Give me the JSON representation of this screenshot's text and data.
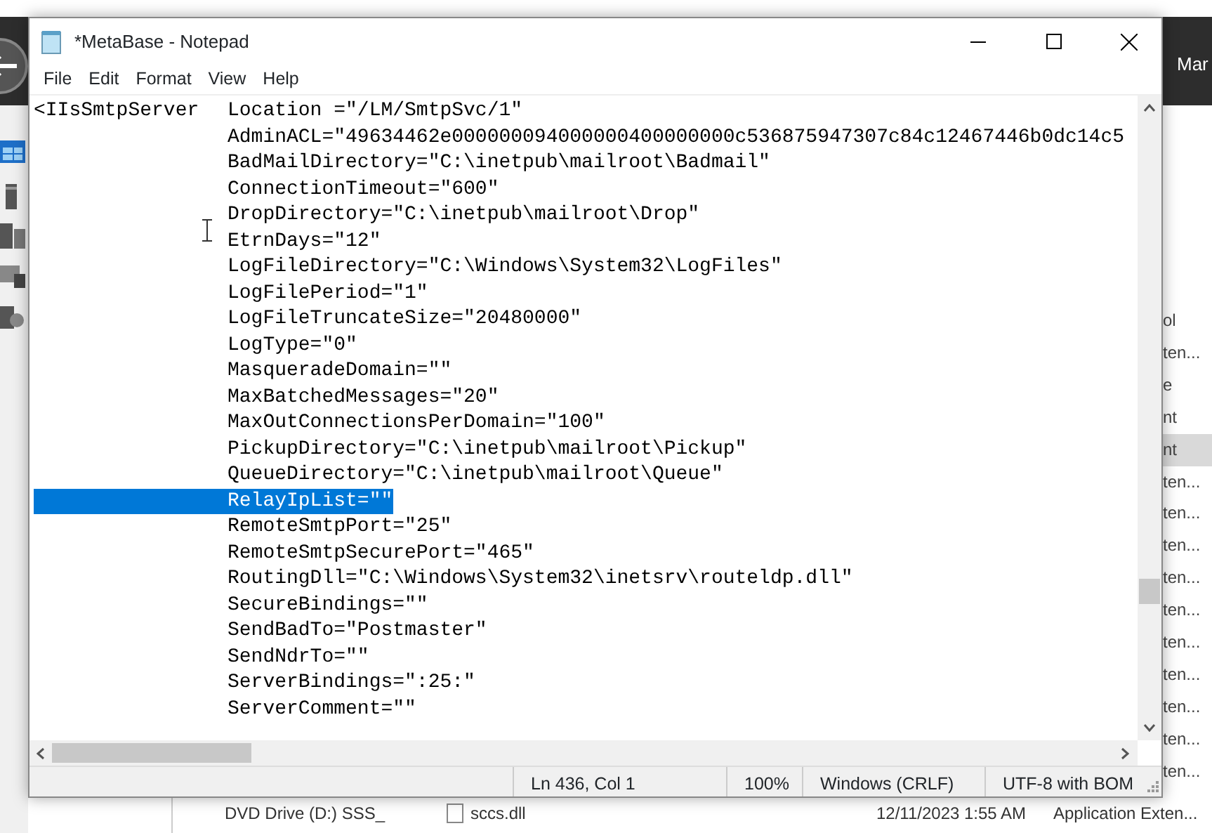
{
  "background": {
    "header_text": "Mar",
    "side_items": [
      {
        "text": "ol",
        "selected": false
      },
      {
        "text": "ten...",
        "selected": false
      },
      {
        "text": "e",
        "selected": false
      },
      {
        "text": "nt",
        "selected": false
      },
      {
        "text": "nt",
        "selected": true
      },
      {
        "text": "ten...",
        "selected": false
      },
      {
        "text": "ten...",
        "selected": false
      },
      {
        "text": "ten...",
        "selected": false
      },
      {
        "text": "ten...",
        "selected": false
      },
      {
        "text": "ten...",
        "selected": false
      },
      {
        "text": "ten...",
        "selected": false
      },
      {
        "text": "ten...",
        "selected": false
      },
      {
        "text": "ten...",
        "selected": false
      },
      {
        "text": "ten...",
        "selected": false
      },
      {
        "text": "ten...",
        "selected": false
      }
    ],
    "files": [
      {
        "name": "DVD Drive (D:) SSS_",
        "file": "sccs.dll",
        "date": "12/11/2023 1:55 AM",
        "type": "Application Exten..."
      }
    ]
  },
  "window": {
    "title": "*MetaBase - Notepad",
    "menu": [
      "File",
      "Edit",
      "Format",
      "View",
      "Help"
    ],
    "lines": [
      {
        "tag": "<IIsSmtpServer",
        "text": "Location =\"/LM/SmtpSvc/1\"",
        "selected": false
      },
      {
        "text": "AdminACL=\"49634462e000000094000000400000000c536875947307c84c12467446b0dc14c5",
        "selected": false
      },
      {
        "text": "BadMailDirectory=\"C:\\inetpub\\mailroot\\Badmail\"",
        "selected": false
      },
      {
        "text": "ConnectionTimeout=\"600\"",
        "selected": false
      },
      {
        "text": "DropDirectory=\"C:\\inetpub\\mailroot\\Drop\"",
        "selected": false
      },
      {
        "text": "EtrnDays=\"12\"",
        "selected": false
      },
      {
        "text": "LogFileDirectory=\"C:\\Windows\\System32\\LogFiles\"",
        "selected": false
      },
      {
        "text": "LogFilePeriod=\"1\"",
        "selected": false
      },
      {
        "text": "LogFileTruncateSize=\"20480000\"",
        "selected": false
      },
      {
        "text": "LogType=\"0\"",
        "selected": false
      },
      {
        "text": "MasqueradeDomain=\"\"",
        "selected": false
      },
      {
        "text": "MaxBatchedMessages=\"20\"",
        "selected": false
      },
      {
        "text": "MaxOutConnectionsPerDomain=\"100\"",
        "selected": false
      },
      {
        "text": "PickupDirectory=\"C:\\inetpub\\mailroot\\Pickup\"",
        "selected": false
      },
      {
        "text": "QueueDirectory=\"C:\\inetpub\\mailroot\\Queue\"",
        "selected": false
      },
      {
        "text": "RelayIpList=\"\"",
        "selected": true
      },
      {
        "text": "RemoteSmtpPort=\"25\"",
        "selected": false
      },
      {
        "text": "RemoteSmtpSecurePort=\"465\"",
        "selected": false
      },
      {
        "text": "RoutingDll=\"C:\\Windows\\System32\\inetsrv\\routeldp.dll\"",
        "selected": false
      },
      {
        "text": "SecureBindings=\"\"",
        "selected": false
      },
      {
        "text": "SendBadTo=\"Postmaster\"",
        "selected": false
      },
      {
        "text": "SendNdrTo=\"\"",
        "selected": false
      },
      {
        "text": "ServerBindings=\":25:\"",
        "selected": false
      },
      {
        "text": "ServerComment=\"\"",
        "selected": false
      }
    ],
    "status_bar": [
      "Ln 436, Col 1",
      "100%",
      "Windows (CRLF)",
      "UTF-8 with BOM"
    ]
  }
}
